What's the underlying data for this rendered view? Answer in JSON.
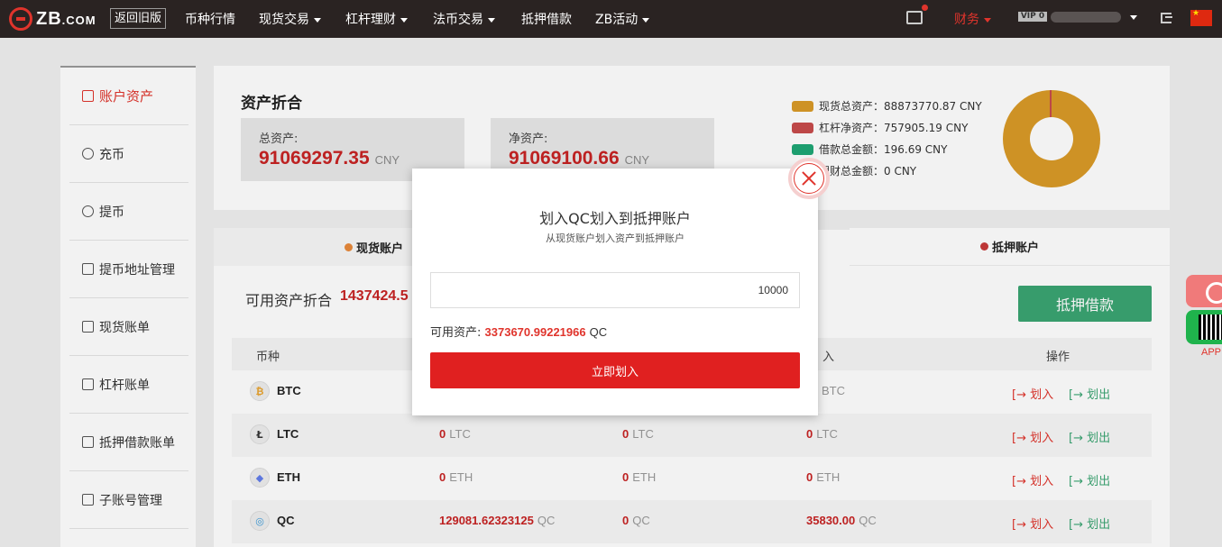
{
  "nav": {
    "logo_main": "ZB",
    "logo_suffix": ".COM",
    "old_version": "返回旧版",
    "items": [
      {
        "label": "币种行情"
      },
      {
        "label": "现货交易"
      },
      {
        "label": "杠杆理财"
      },
      {
        "label": "法币交易"
      },
      {
        "label": "抵押借款"
      },
      {
        "label": "ZB活动"
      }
    ],
    "finance": "财务",
    "vip": "VIP 0"
  },
  "sidebar": {
    "items": [
      {
        "label": "账户资产"
      },
      {
        "label": "充币"
      },
      {
        "label": "提币"
      },
      {
        "label": "提币地址管理"
      },
      {
        "label": "现货账单"
      },
      {
        "label": "杠杆账单"
      },
      {
        "label": "抵押借款账单"
      },
      {
        "label": "子账号管理"
      }
    ]
  },
  "assets": {
    "title": "资产折合",
    "total_label": "总资产:",
    "total_value": "91069297.35",
    "net_label": "净资产:",
    "net_value": "91069100.66",
    "unit": "CNY",
    "legend": [
      {
        "label": "现货总资产：88873770.87 CNY",
        "color": "#da9a28"
      },
      {
        "label": "杠杆净资产：757905.19 CNY",
        "color": "#c84b4b"
      },
      {
        "label": "借款总金额：196.69 CNY",
        "color": "#1fa775"
      },
      {
        "label": "理财总金额：0 CNY",
        "color": "#3b8fd9"
      }
    ]
  },
  "tabs": {
    "spot": "现货账户",
    "pledge": "抵押账户"
  },
  "available": {
    "label": "可用资产折合",
    "value": "1437424.5"
  },
  "pledge_button": "抵押借款",
  "table": {
    "headers": {
      "coin": "币种",
      "in": "入",
      "action": "操作"
    },
    "rows": [
      {
        "icon": "₿",
        "coin": "BTC",
        "c1": "",
        "c1u": "",
        "c2": "",
        "c2u": "",
        "c3": "",
        "c3u": "BTC"
      },
      {
        "icon": "Ł",
        "coin": "LTC",
        "c1": "0",
        "c1u": "LTC",
        "c2": "0",
        "c2u": "LTC",
        "c3": "0",
        "c3u": "LTC"
      },
      {
        "icon": "◆",
        "coin": "ETH",
        "c1": "0",
        "c1u": "ETH",
        "c2": "0",
        "c2u": "ETH",
        "c3": "0",
        "c3u": "ETH"
      },
      {
        "icon": "◎",
        "coin": "QC",
        "c1": "129081.62323125",
        "c1u": "QC",
        "c2": "0",
        "c2u": "QC",
        "c3": "35830.00",
        "c3u": "QC"
      }
    ],
    "action_in": "划入",
    "action_out": "划出"
  },
  "float": {
    "app": "APP"
  },
  "modal": {
    "title": "划入QC划入到抵押账户",
    "subtitle": "从现货账户划入资产到抵押账户",
    "input_value": "10000",
    "avail_label": "可用资产:",
    "avail_value": "3373670.99221966",
    "avail_unit": "QC",
    "confirm": "立即划入"
  }
}
